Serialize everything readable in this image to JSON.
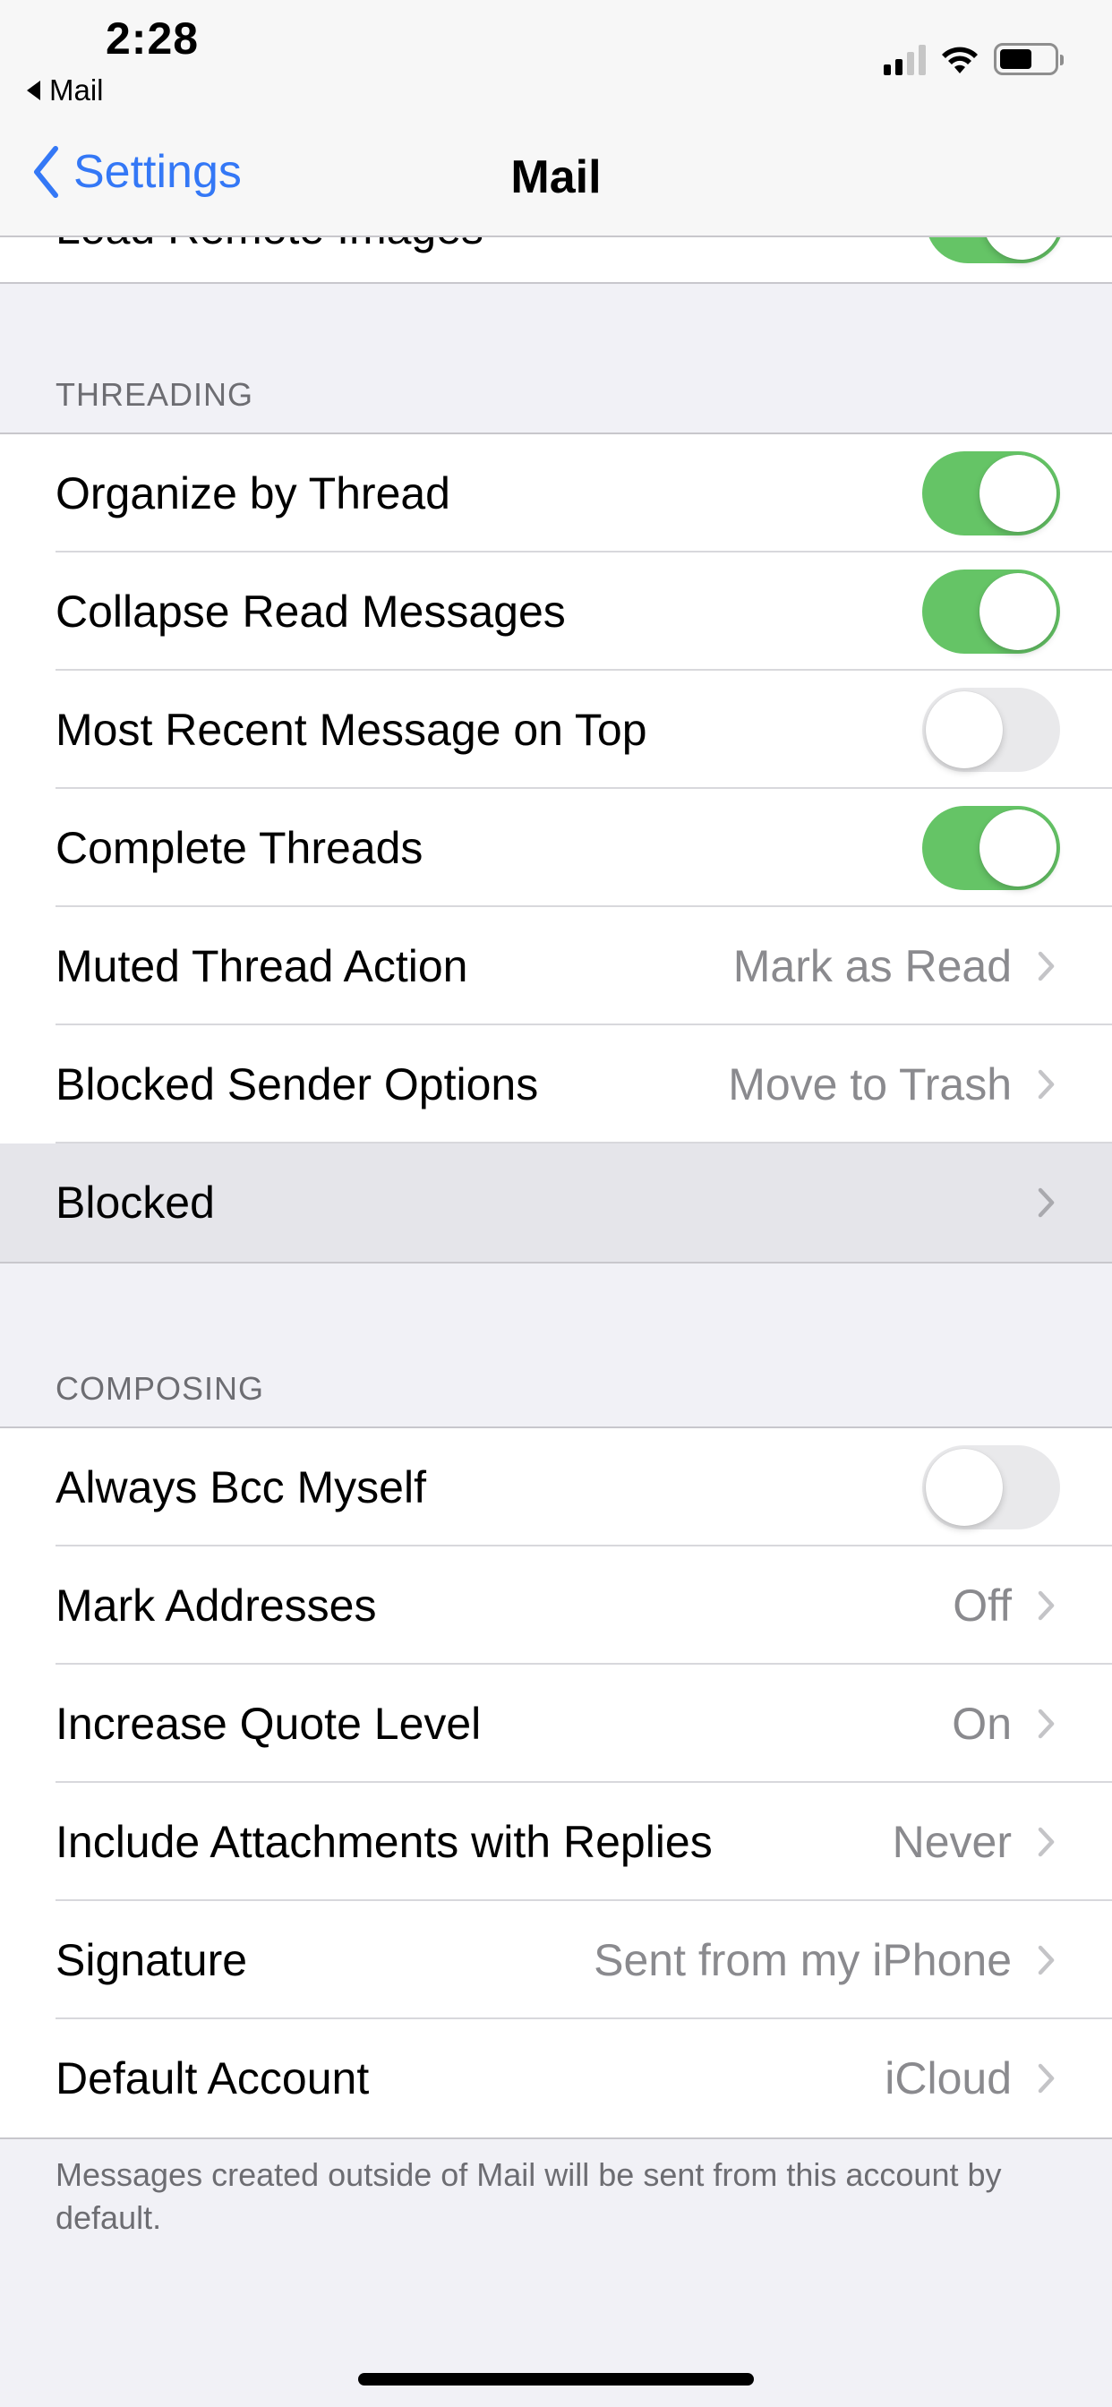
{
  "status_bar": {
    "time": "2:28",
    "back_app": "Mail",
    "signal_bars_active": 2,
    "signal_bars_total": 4,
    "battery_level": 0.6
  },
  "nav": {
    "back_label": "Settings",
    "title": "Mail"
  },
  "partial_row": {
    "label": "Load Remote Images",
    "toggle_on": true
  },
  "threading": {
    "header": "THREADING",
    "rows": [
      {
        "label": "Organize by Thread",
        "type": "toggle",
        "on": true
      },
      {
        "label": "Collapse Read Messages",
        "type": "toggle",
        "on": true
      },
      {
        "label": "Most Recent Message on Top",
        "type": "toggle",
        "on": false
      },
      {
        "label": "Complete Threads",
        "type": "toggle",
        "on": true
      },
      {
        "label": "Muted Thread Action",
        "type": "disclosure",
        "value": "Mark as Read"
      },
      {
        "label": "Blocked Sender Options",
        "type": "disclosure",
        "value": "Move to Trash"
      },
      {
        "label": "Blocked",
        "type": "disclosure",
        "value": "",
        "highlighted": true
      }
    ]
  },
  "composing": {
    "header": "COMPOSING",
    "rows": [
      {
        "label": "Always Bcc Myself",
        "type": "toggle",
        "on": false
      },
      {
        "label": "Mark Addresses",
        "type": "disclosure",
        "value": "Off"
      },
      {
        "label": "Increase Quote Level",
        "type": "disclosure",
        "value": "On"
      },
      {
        "label": "Include Attachments with Replies",
        "type": "disclosure",
        "value": "Never"
      },
      {
        "label": "Signature",
        "type": "disclosure",
        "value": "Sent from my iPhone"
      },
      {
        "label": "Default Account",
        "type": "disclosure",
        "value": "iCloud"
      }
    ],
    "footer": "Messages created outside of Mail will be sent from this account by default."
  },
  "colors": {
    "accent": "#3478f6",
    "toggle_on": "#65c466",
    "toggle_off": "#e9e9eb",
    "background": "#f1f1f6",
    "secondary_text": "#8a8a8e",
    "highlight": "#e5e5ea"
  }
}
